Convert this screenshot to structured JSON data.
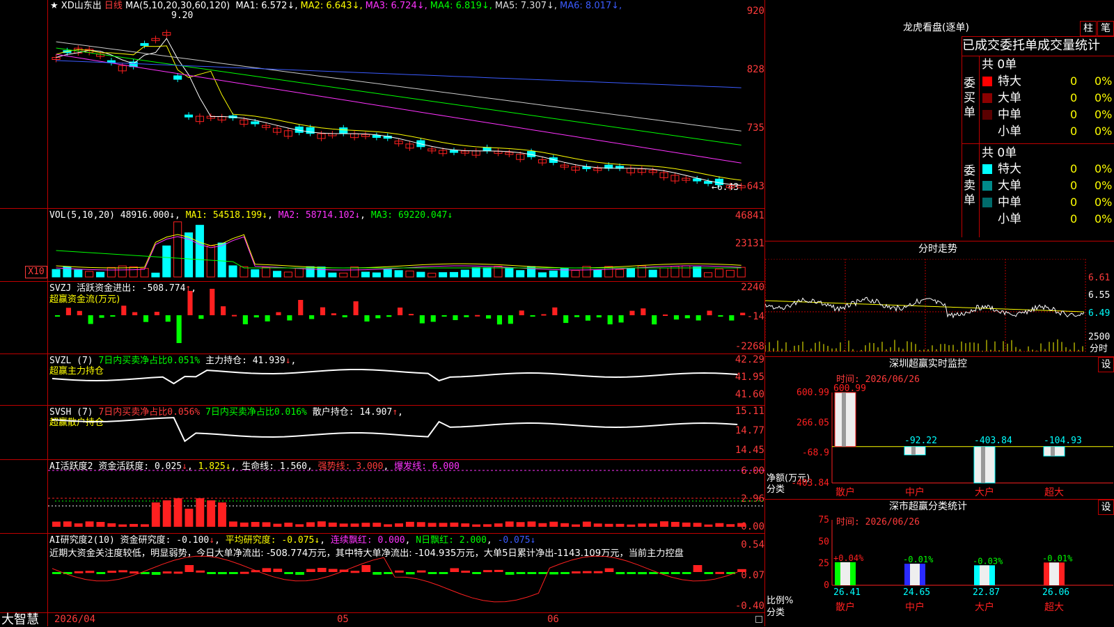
{
  "app": {
    "name": "大智慧"
  },
  "main_chart": {
    "star": "★",
    "stock": "XD山东出",
    "period": "日线",
    "ma_params": "MA(5,10,20,30,60,120)",
    "ma_values": [
      {
        "label": "MA1:",
        "value": "6.572",
        "color": "#ffffff"
      },
      {
        "label": "MA2:",
        "value": "6.643",
        "color": "#ffff00"
      },
      {
        "label": "MA3:",
        "value": "6.724",
        "color": "#ff33ff"
      },
      {
        "label": "MA4:",
        "value": "6.819",
        "color": "#00ff00"
      },
      {
        "label": "MA5:",
        "value": "7.307",
        "color": "#dddddd"
      },
      {
        "label": "MA6:",
        "value": "8.017",
        "color": "#3b5bff"
      }
    ],
    "y_ticks": [
      "920",
      "828",
      "735",
      "643"
    ],
    "high_label": "9.20",
    "low_label": "←6.43"
  },
  "volume": {
    "title": "VOL(5,10,20)",
    "value": "48916.000",
    "ma1": "MA1: 54518.199",
    "ma2": "MA2: 58714.102",
    "ma3": "MA3: 69220.047",
    "y_ticks": [
      "46841",
      "23131"
    ],
    "unit": "X10"
  },
  "svzj": {
    "title": "SVZJ",
    "desc": "活跃资金进出: -508.774",
    "sub": "超赢资金流(万元)",
    "y_ticks": [
      "2240",
      "-14",
      "-2268"
    ]
  },
  "svzl": {
    "title": "SVZL (7)",
    "desc1": "7日内买卖净占比0.051%",
    "desc2": "主力持仓: 41.939",
    "sub": "超赢主力持仓",
    "y_ticks": [
      "42.29",
      "41.95",
      "41.60"
    ]
  },
  "svsh": {
    "title": "SVSH (7)",
    "desc1": "7日内买卖净占比0.056%",
    "desc2": "7日内买卖净占比0.016%",
    "desc3": "散户持仓: 14.907",
    "sub": "超赢散户持仓",
    "y_ticks": [
      "15.11",
      "14.77",
      "14.45"
    ]
  },
  "ai_active": {
    "title": "AI活跃度2",
    "desc": "资金活跃度: 0.025",
    "v2": "1.825",
    "life": "生命线: 1.560",
    "strong": "强势线: 3.000",
    "burst": "爆发线: 6.000",
    "y_ticks": [
      "6.00",
      "2.96",
      "0.00"
    ]
  },
  "ai_research": {
    "title": "AI研究度2(10)",
    "desc": "资金研究度: -0.100",
    "avg": "平均研究度: -0.075",
    "streak": "连续飘红: 0.000",
    "nday": "N日飘红: 2.000",
    "v5": "-0.075",
    "comment": "近期大资金关注度较低，明显弱势，今日大单净流出: -508.774万元，其中特大单净流出: -104.935万元，大单5日累计净出-1143.109万元，当前主力控盘",
    "y_ticks": [
      "0.54",
      "0.07",
      "-0.40"
    ]
  },
  "date_axis": {
    "labels": [
      "2026/04",
      "05",
      "06"
    ]
  },
  "dragon": {
    "title": "龙虎看盘(逐单)",
    "btn_bar": "柱",
    "btn_pen": "笔",
    "header": "已成交委托单成交量统计",
    "buy_label": "委买单",
    "sell_label": "委卖单",
    "buy_total": "共 0单",
    "sell_total": "共 0单",
    "buy_rows": [
      {
        "name": "特大",
        "count": "0",
        "pct": "0%",
        "color": "#ff0000"
      },
      {
        "name": "大单",
        "count": "0",
        "pct": "0%",
        "color": "#8b0000"
      },
      {
        "name": "中单",
        "count": "0",
        "pct": "0%",
        "color": "#5a0000"
      },
      {
        "name": "小单",
        "count": "0",
        "pct": "0%",
        "color": "#000000"
      }
    ],
    "sell_rows": [
      {
        "name": "特大",
        "count": "0",
        "pct": "0%",
        "color": "#00ffff"
      },
      {
        "name": "大单",
        "count": "0",
        "pct": "0%",
        "color": "#008b8b"
      },
      {
        "name": "中单",
        "count": "0",
        "pct": "0%",
        "color": "#006b6b"
      },
      {
        "name": "小单",
        "count": "0",
        "pct": "0%",
        "color": "#000000"
      }
    ]
  },
  "intraday": {
    "title": "分时走势",
    "y_ticks": [
      "6.61",
      "6.55",
      "6.49",
      "2500"
    ],
    "vol_label": "分时"
  },
  "sz_monitor": {
    "title": "深圳超赢实时监控",
    "btn": "设",
    "time_label": "时间: 2026/06/26",
    "y_ticks": [
      "600.99",
      "266.05",
      "-68.9",
      "-403.84"
    ],
    "unit": "净额(万元)",
    "cat_label": "分类",
    "chart_data": {
      "type": "bar",
      "categories": [
        "散户",
        "中户",
        "大户",
        "超大"
      ],
      "values": [
        600.99,
        -92.22,
        -403.84,
        -104.93
      ],
      "value_labels": [
        "600.99",
        "-92.22",
        "-403.84",
        "-104.93"
      ],
      "ylim": [
        -403.84,
        600.99
      ]
    }
  },
  "sz_class": {
    "title": "深市超赢分类统计",
    "btn": "设",
    "time_label": "时间: 2026/06/26",
    "y_ticks": [
      "75",
      "50",
      "25",
      "0"
    ],
    "unit": "比例%",
    "cat_label": "分类",
    "chart_data": {
      "type": "bar",
      "categories": [
        "散户",
        "中户",
        "大户",
        "超大"
      ],
      "values": [
        26.41,
        24.65,
        22.87,
        26.06
      ],
      "change_labels": [
        "+0.04%",
        "-0.01%",
        "-0.03%",
        "-0.01%"
      ],
      "value_labels": [
        "26.41",
        "24.65",
        "22.87",
        "26.06"
      ],
      "colors": [
        "#00ff00",
        "#2a2aff",
        "#00ffff",
        "#ff2020"
      ],
      "ylim": [
        0,
        75
      ]
    }
  }
}
